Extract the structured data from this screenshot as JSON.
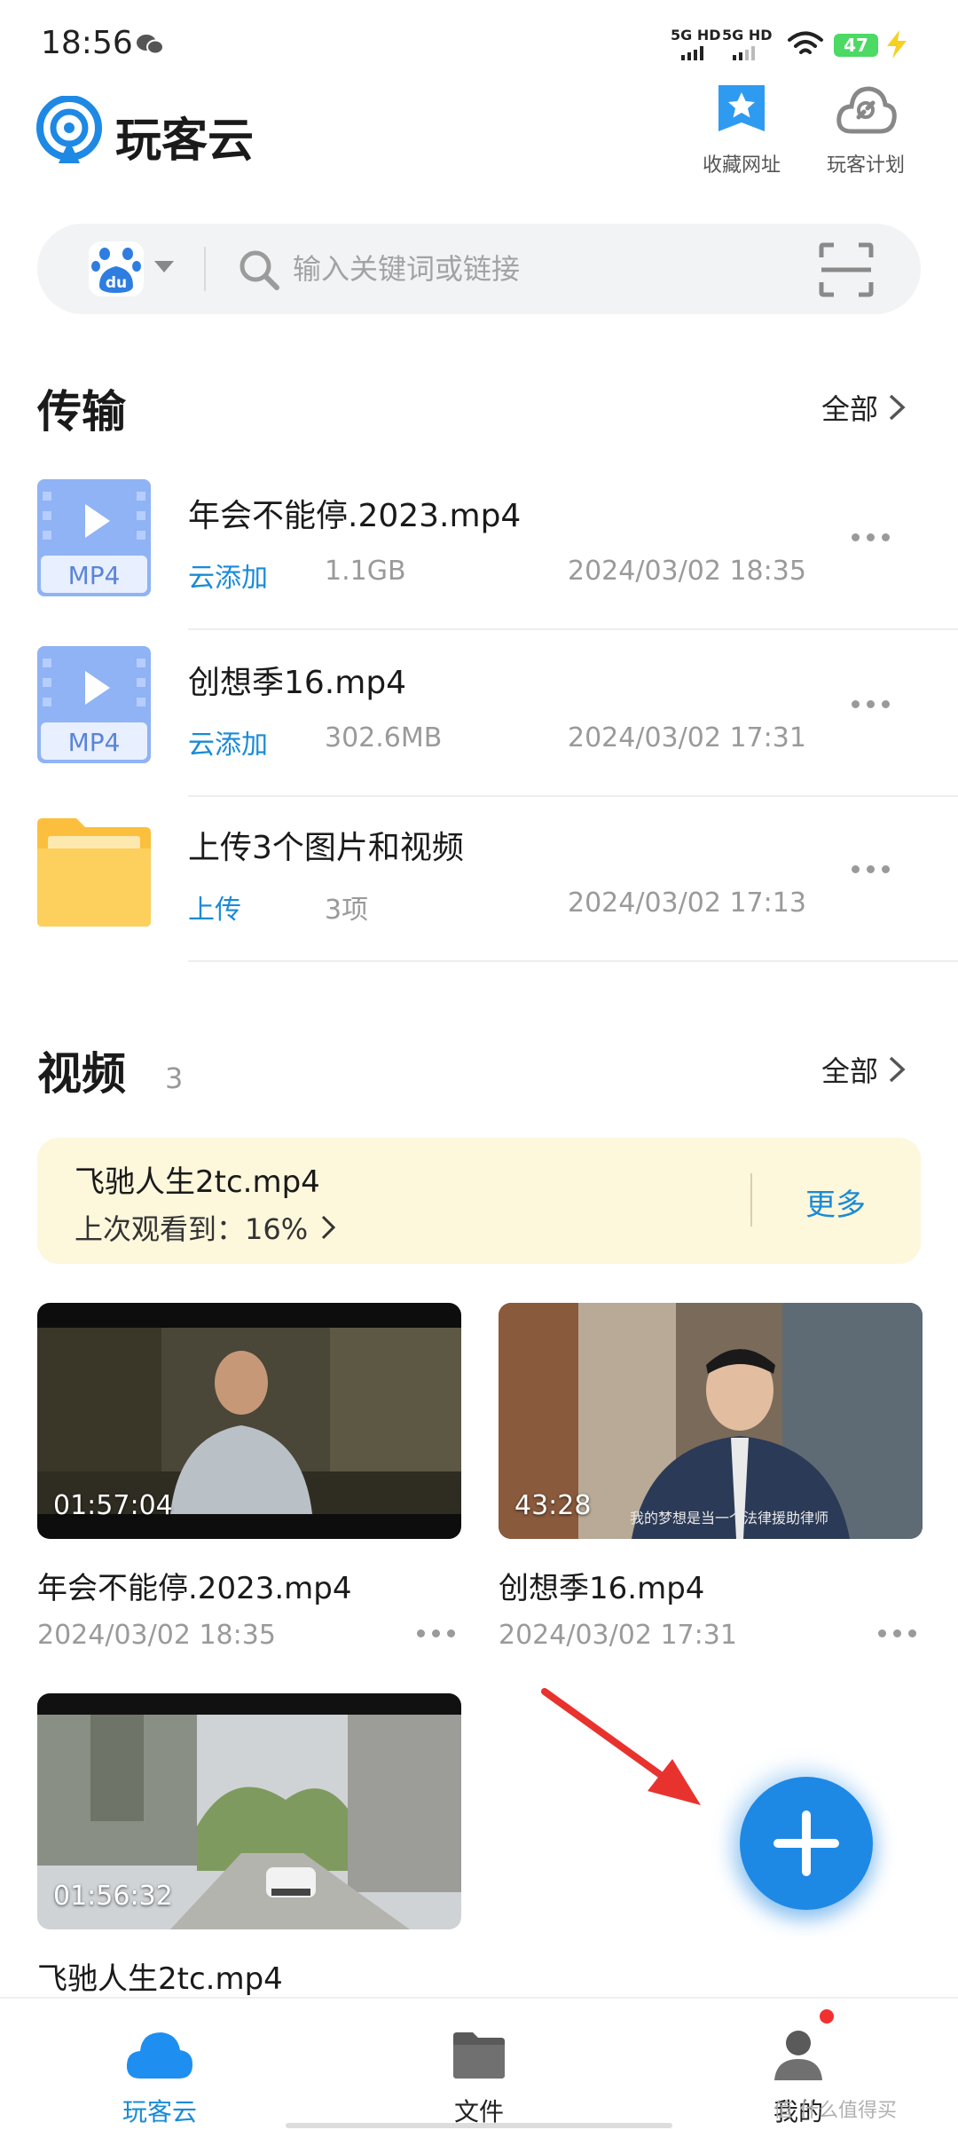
{
  "status_bar": {
    "time": "18:56",
    "sim1_label": "5G HD",
    "sim2_label": "5G HD",
    "battery_level": "47",
    "icons": [
      "wechat-icon",
      "signal-icon",
      "wifi-icon",
      "battery-icon",
      "charging-icon"
    ]
  },
  "header": {
    "app_title": "玩客云",
    "bookmarks_label": "收藏网址",
    "plan_label": "玩客计划"
  },
  "search": {
    "engine": "du",
    "placeholder": "输入关键词或链接"
  },
  "transfer": {
    "title": "传输",
    "all_label": "全部",
    "items": [
      {
        "name": "年会不能停.2023.mp4",
        "type": "云添加",
        "size": "1.1GB",
        "date": "2024/03/02 18:35",
        "icon": "MP4"
      },
      {
        "name": "创想季16.mp4",
        "type": "云添加",
        "size": "302.6MB",
        "date": "2024/03/02 17:31",
        "icon": "MP4"
      },
      {
        "name": "上传3个图片和视频",
        "type": "上传",
        "size": "3项",
        "date": "2024/03/02 17:13",
        "icon": "folder"
      }
    ]
  },
  "videos": {
    "title": "视频",
    "count": "3",
    "all_label": "全部",
    "resume": {
      "name": "飞驰人生2tc.mp4",
      "progress": "上次观看到：16%",
      "more_label": "更多"
    },
    "items": [
      {
        "name": "年会不能停.2023.mp4",
        "duration": "01:57:04",
        "date": "2024/03/02 18:35"
      },
      {
        "name": "创想季16.mp4",
        "duration": "43:28",
        "date": "2024/03/02 17:31",
        "subtitle": "我的梦想是当一个法律援助律师"
      },
      {
        "name": "飞驰人生2tc.mp4",
        "duration": "01:56:32"
      }
    ]
  },
  "bottom_nav": {
    "tabs": [
      {
        "label": "玩客云",
        "icon": "cloud-icon",
        "active": true
      },
      {
        "label": "文件",
        "icon": "folder-icon",
        "active": false
      },
      {
        "label": "我的",
        "icon": "person-icon",
        "active": false
      }
    ]
  },
  "watermark": "值 什么值得买",
  "colors": {
    "accent": "#1a8bd6",
    "fab": "#1e88e5",
    "resume_bg": "#fdf7dc",
    "arrow": "#e8322e"
  }
}
